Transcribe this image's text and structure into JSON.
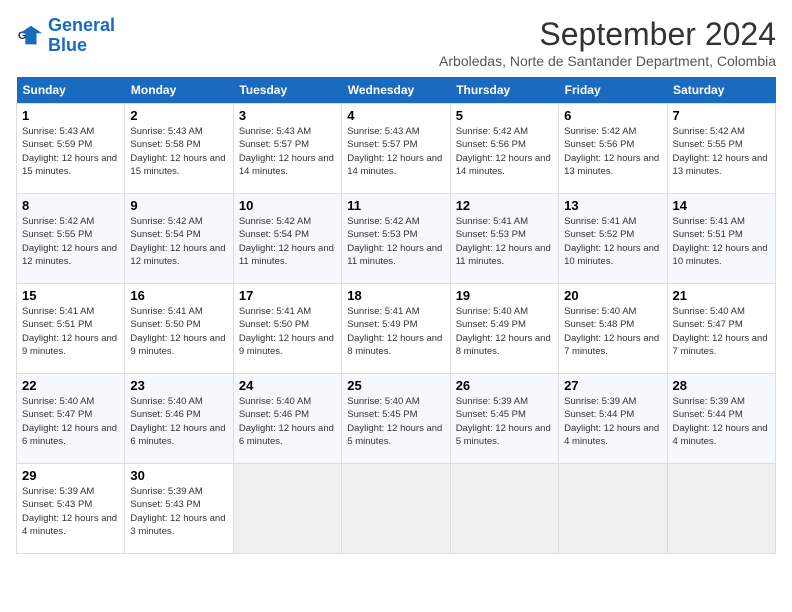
{
  "logo": {
    "line1": "General",
    "line2": "Blue"
  },
  "title": {
    "month_year": "September 2024",
    "location": "Arboledas, Norte de Santander Department, Colombia"
  },
  "weekdays": [
    "Sunday",
    "Monday",
    "Tuesday",
    "Wednesday",
    "Thursday",
    "Friday",
    "Saturday"
  ],
  "days": [
    {
      "date": 1,
      "sunrise": "5:43 AM",
      "sunset": "5:59 PM",
      "daylight": "12 hours and 15 minutes."
    },
    {
      "date": 2,
      "sunrise": "5:43 AM",
      "sunset": "5:58 PM",
      "daylight": "12 hours and 15 minutes."
    },
    {
      "date": 3,
      "sunrise": "5:43 AM",
      "sunset": "5:57 PM",
      "daylight": "12 hours and 14 minutes."
    },
    {
      "date": 4,
      "sunrise": "5:43 AM",
      "sunset": "5:57 PM",
      "daylight": "12 hours and 14 minutes."
    },
    {
      "date": 5,
      "sunrise": "5:42 AM",
      "sunset": "5:56 PM",
      "daylight": "12 hours and 14 minutes."
    },
    {
      "date": 6,
      "sunrise": "5:42 AM",
      "sunset": "5:56 PM",
      "daylight": "12 hours and 13 minutes."
    },
    {
      "date": 7,
      "sunrise": "5:42 AM",
      "sunset": "5:55 PM",
      "daylight": "12 hours and 13 minutes."
    },
    {
      "date": 8,
      "sunrise": "5:42 AM",
      "sunset": "5:55 PM",
      "daylight": "12 hours and 12 minutes."
    },
    {
      "date": 9,
      "sunrise": "5:42 AM",
      "sunset": "5:54 PM",
      "daylight": "12 hours and 12 minutes."
    },
    {
      "date": 10,
      "sunrise": "5:42 AM",
      "sunset": "5:54 PM",
      "daylight": "12 hours and 11 minutes."
    },
    {
      "date": 11,
      "sunrise": "5:42 AM",
      "sunset": "5:53 PM",
      "daylight": "12 hours and 11 minutes."
    },
    {
      "date": 12,
      "sunrise": "5:41 AM",
      "sunset": "5:53 PM",
      "daylight": "12 hours and 11 minutes."
    },
    {
      "date": 13,
      "sunrise": "5:41 AM",
      "sunset": "5:52 PM",
      "daylight": "12 hours and 10 minutes."
    },
    {
      "date": 14,
      "sunrise": "5:41 AM",
      "sunset": "5:51 PM",
      "daylight": "12 hours and 10 minutes."
    },
    {
      "date": 15,
      "sunrise": "5:41 AM",
      "sunset": "5:51 PM",
      "daylight": "12 hours and 9 minutes."
    },
    {
      "date": 16,
      "sunrise": "5:41 AM",
      "sunset": "5:50 PM",
      "daylight": "12 hours and 9 minutes."
    },
    {
      "date": 17,
      "sunrise": "5:41 AM",
      "sunset": "5:50 PM",
      "daylight": "12 hours and 9 minutes."
    },
    {
      "date": 18,
      "sunrise": "5:41 AM",
      "sunset": "5:49 PM",
      "daylight": "12 hours and 8 minutes."
    },
    {
      "date": 19,
      "sunrise": "5:40 AM",
      "sunset": "5:49 PM",
      "daylight": "12 hours and 8 minutes."
    },
    {
      "date": 20,
      "sunrise": "5:40 AM",
      "sunset": "5:48 PM",
      "daylight": "12 hours and 7 minutes."
    },
    {
      "date": 21,
      "sunrise": "5:40 AM",
      "sunset": "5:47 PM",
      "daylight": "12 hours and 7 minutes."
    },
    {
      "date": 22,
      "sunrise": "5:40 AM",
      "sunset": "5:47 PM",
      "daylight": "12 hours and 6 minutes."
    },
    {
      "date": 23,
      "sunrise": "5:40 AM",
      "sunset": "5:46 PM",
      "daylight": "12 hours and 6 minutes."
    },
    {
      "date": 24,
      "sunrise": "5:40 AM",
      "sunset": "5:46 PM",
      "daylight": "12 hours and 6 minutes."
    },
    {
      "date": 25,
      "sunrise": "5:40 AM",
      "sunset": "5:45 PM",
      "daylight": "12 hours and 5 minutes."
    },
    {
      "date": 26,
      "sunrise": "5:39 AM",
      "sunset": "5:45 PM",
      "daylight": "12 hours and 5 minutes."
    },
    {
      "date": 27,
      "sunrise": "5:39 AM",
      "sunset": "5:44 PM",
      "daylight": "12 hours and 4 minutes."
    },
    {
      "date": 28,
      "sunrise": "5:39 AM",
      "sunset": "5:44 PM",
      "daylight": "12 hours and 4 minutes."
    },
    {
      "date": 29,
      "sunrise": "5:39 AM",
      "sunset": "5:43 PM",
      "daylight": "12 hours and 4 minutes."
    },
    {
      "date": 30,
      "sunrise": "5:39 AM",
      "sunset": "5:43 PM",
      "daylight": "12 hours and 3 minutes."
    }
  ],
  "start_day": 0
}
